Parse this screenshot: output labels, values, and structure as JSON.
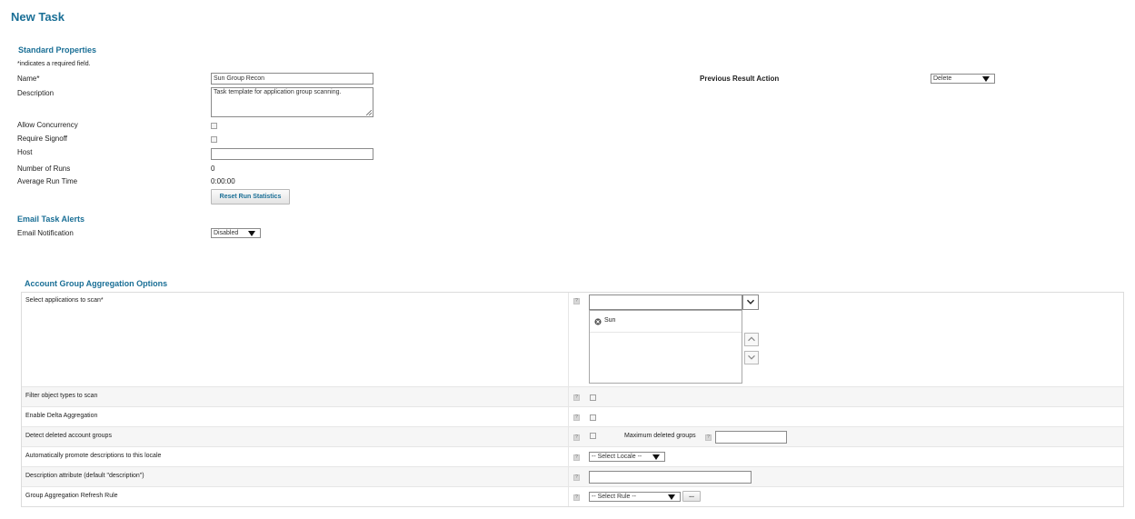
{
  "page_title": "New Task",
  "standard": {
    "title": "Standard Properties",
    "required_note": "*indicates a required field.",
    "name_label": "Name",
    "required_mark": "*",
    "name_value": "Sun Group Recon",
    "description_label": "Description",
    "description_value": "Task template for application group scanning.",
    "allow_concurrency_label": "Allow Concurrency",
    "require_signoff_label": "Require Signoff",
    "host_label": "Host",
    "host_value": "",
    "number_of_runs_label": "Number of Runs",
    "number_of_runs_value": "0",
    "average_run_time_label": "Average Run Time",
    "average_run_time_value": "0:00:00",
    "reset_button": "Reset Run Statistics",
    "previous_result_label": "Previous Result Action",
    "previous_result_value": "Delete"
  },
  "email": {
    "title": "Email Task Alerts",
    "notification_label": "Email Notification",
    "notification_value": "Disabled"
  },
  "aggregation": {
    "title": "Account Group Aggregation Options",
    "apps_label": "Select applications to scan",
    "apps_required_mark": "*",
    "apps_search_value": "",
    "selected_apps": [
      "Sun"
    ],
    "filter_label": "Filter object types to scan",
    "delta_label": "Enable Delta Aggregation",
    "detect_deleted_label": "Detect deleted account groups",
    "max_deleted_label": "Maximum deleted groups",
    "max_deleted_value": "",
    "promote_label": "Automatically promote descriptions to this locale",
    "locale_value": "-- Select Locale --",
    "desc_attr_label": "Description attribute (default \"description\")",
    "desc_attr_value": "",
    "refresh_rule_label": "Group Aggregation Refresh Rule",
    "rule_value": "-- Select Rule --",
    "rule_browse_label": "...",
    "help_glyph": "?"
  },
  "colors": {
    "accent": "#1a6f96",
    "border": "#8a8a8a"
  }
}
